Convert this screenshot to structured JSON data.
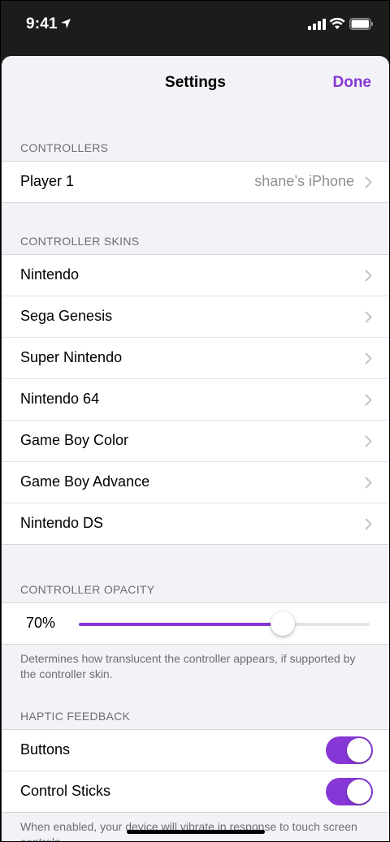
{
  "status_bar": {
    "time": "9:41"
  },
  "nav": {
    "title": "Settings",
    "done_label": "Done"
  },
  "sections": {
    "controllers": {
      "header": "CONTROLLERS",
      "rows": [
        {
          "label": "Player 1",
          "value": "shane’s iPhone"
        }
      ]
    },
    "controller_skins": {
      "header": "CONTROLLER SKINS",
      "rows": [
        {
          "label": "Nintendo"
        },
        {
          "label": "Sega Genesis"
        },
        {
          "label": "Super Nintendo"
        },
        {
          "label": "Nintendo 64"
        },
        {
          "label": "Game Boy Color"
        },
        {
          "label": "Game Boy Advance"
        },
        {
          "label": "Nintendo DS"
        }
      ]
    },
    "controller_opacity": {
      "header": "CONTROLLER OPACITY",
      "value_label": "70%",
      "slider_level": 0.7,
      "footer": "Determines how translucent the controller appears, if supported by the controller skin."
    },
    "haptic_feedback": {
      "header": "HAPTIC FEEDBACK",
      "rows": [
        {
          "label": "Buttons",
          "enabled": true
        },
        {
          "label": "Control Sticks",
          "enabled": true
        }
      ],
      "footer": "When enabled, your device will vibrate in response to touch screen controls."
    }
  },
  "colors": {
    "accent": "#8637d6",
    "background": "#f2f2f7",
    "secondary_text": "#6d6d72"
  },
  "icons": [
    "location-arrow-icon",
    "cellular-signal-icon",
    "wifi-icon",
    "battery-icon",
    "chevron-right-icon"
  ]
}
